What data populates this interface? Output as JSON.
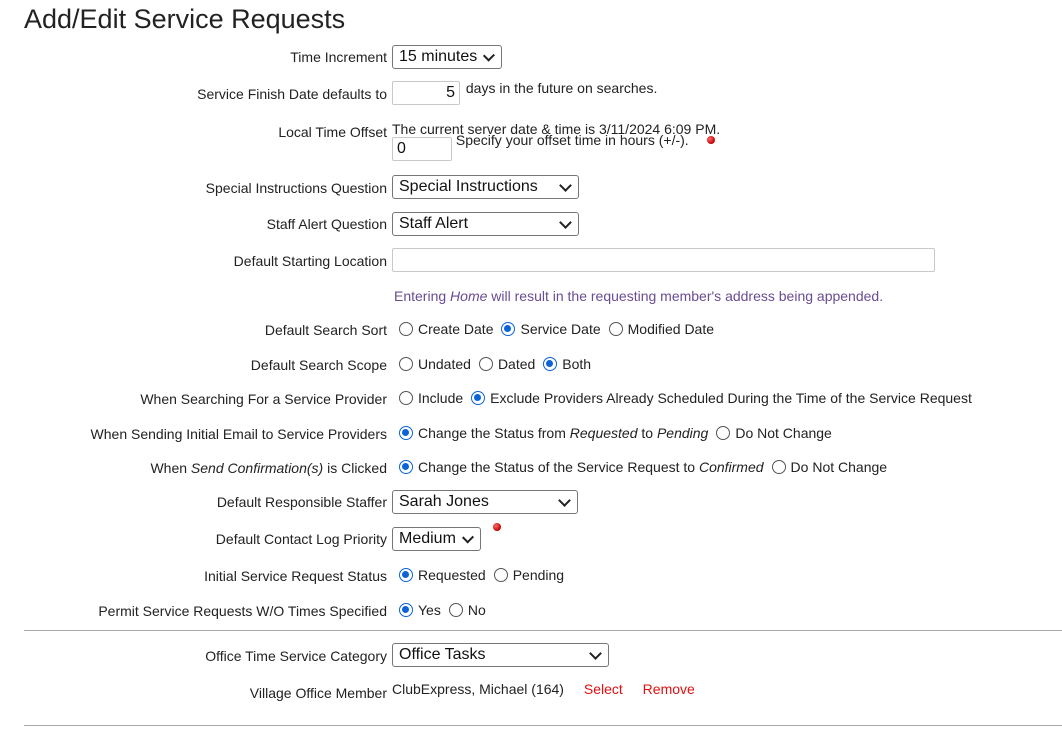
{
  "page": {
    "title": "Add/Edit Service Requests"
  },
  "time_increment": {
    "label": "Time Increment",
    "value": "15 minutes"
  },
  "finish_date": {
    "label": "Service Finish Date defaults to",
    "value": "5",
    "suffix": "days in the future on searches."
  },
  "time_offset": {
    "label": "Local Time Offset",
    "server_text": "The current server date & time is 3/11/2024 6:09 PM.",
    "value": "0",
    "help": "Specify your offset time in hours (+/-)."
  },
  "special_instructions": {
    "label": "Special Instructions Question",
    "value": "Special Instructions"
  },
  "staff_alert": {
    "label": "Staff Alert Question",
    "value": "Staff Alert"
  },
  "starting_location": {
    "label": "Default Starting Location",
    "value": "",
    "hint_pre": "Entering ",
    "hint_em": "Home",
    "hint_post": " will result in the requesting member's address being appended."
  },
  "search_sort": {
    "label": "Default Search Sort",
    "options": [
      "Create Date",
      "Service Date",
      "Modified Date"
    ],
    "selected": "Service Date"
  },
  "search_scope": {
    "label": "Default Search Scope",
    "options": [
      "Undated",
      "Dated",
      "Both"
    ],
    "selected": "Both"
  },
  "provider_search": {
    "label": "When Searching For a Service Provider",
    "options": [
      "Include",
      "Exclude Providers Already Scheduled During the Time of the Service Request"
    ],
    "selected": "Exclude"
  },
  "initial_email": {
    "label": "When Sending Initial Email to Service Providers",
    "opt1_pre": "Change the Status from ",
    "opt1_em1": "Requested",
    "opt1_mid": " to ",
    "opt1_em2": "Pending",
    "opt2": "Do Not Change"
  },
  "send_confirmation": {
    "label_pre": "When ",
    "label_em": "Send Confirmation(s)",
    "label_post": " is Clicked",
    "opt1_pre": "Change the Status of the Service Request to ",
    "opt1_em": "Confirmed",
    "opt2": "Do Not Change"
  },
  "responsible_staffer": {
    "label": "Default Responsible Staffer",
    "value": "Sarah Jones"
  },
  "contact_priority": {
    "label": "Default Contact Log Priority",
    "value": "Medium"
  },
  "initial_status": {
    "label": "Initial Service Request Status",
    "options": [
      "Requested",
      "Pending"
    ]
  },
  "permit_no_times": {
    "label": "Permit Service Requests W/O Times Specified",
    "options": [
      "Yes",
      "No"
    ]
  },
  "office_category": {
    "label": "Office Time Service Category",
    "value": "Office Tasks"
  },
  "village_member": {
    "label": "Village Office Member",
    "value": "ClubExpress, Michael (164)",
    "select_link": "Select",
    "remove_link": "Remove"
  }
}
